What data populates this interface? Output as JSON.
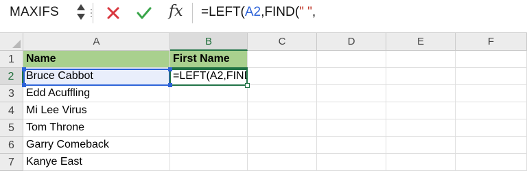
{
  "formula_bar": {
    "name_box": "MAXIFS",
    "fx_label": "fx",
    "formula_prefix": "=LEFT(",
    "formula_ref": "A2",
    "formula_mid": ",FIND(",
    "formula_quote": "\" \"",
    "formula_suffix": ","
  },
  "grid": {
    "columns": [
      "A",
      "B",
      "C",
      "D",
      "E",
      "F"
    ],
    "rows": [
      "1",
      "2",
      "3",
      "4",
      "5",
      "6",
      "7"
    ],
    "cells": {
      "A1": "Name",
      "B1": "First Name",
      "A2": "Bruce Cabbot",
      "B2": "=LEFT(A2,FIND(\" \",",
      "A3": "Edd Acuffling",
      "A4": "Mi Lee Virus",
      "A5": "Tom Throne",
      "A6": "Garry Comeback",
      "A7": "Kanye East"
    },
    "header_fill_color": "#a9d08e",
    "active_reference_color": "#2d63d8",
    "selection_color": "#217346"
  },
  "icons": {
    "cancel": "cancel-icon",
    "enter": "enter-icon",
    "function": "fx-icon"
  }
}
